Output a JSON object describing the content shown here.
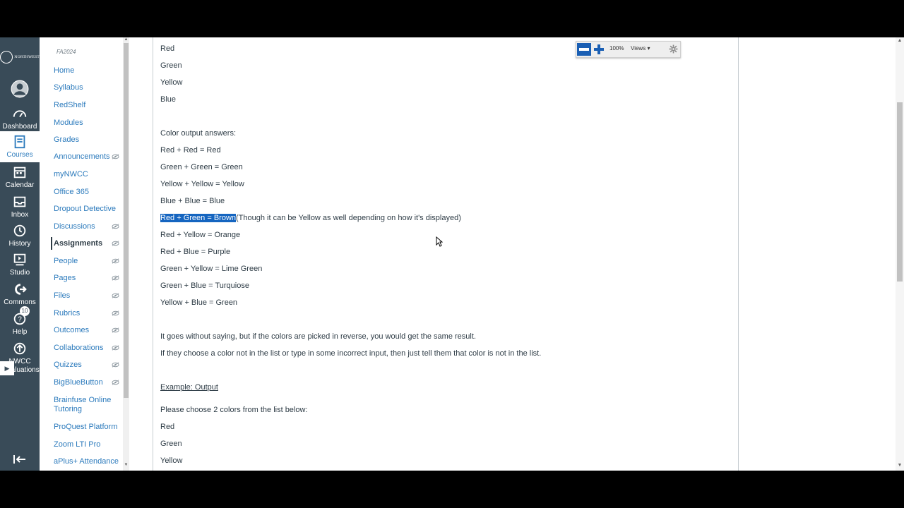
{
  "global_nav": {
    "logo_text": "NORTHWEST",
    "items": [
      {
        "label": "Dashboard"
      },
      {
        "label": "Courses"
      },
      {
        "label": "Calendar"
      },
      {
        "label": "Inbox"
      },
      {
        "label": "History"
      },
      {
        "label": "Studio"
      },
      {
        "label": "Commons"
      },
      {
        "label": "Help",
        "badge": "10"
      },
      {
        "label": "NWCC Evaluations"
      }
    ]
  },
  "course_nav": {
    "term": "FA2024",
    "items": [
      {
        "label": "Home",
        "hidden": false
      },
      {
        "label": "Syllabus",
        "hidden": false
      },
      {
        "label": "RedShelf",
        "hidden": false
      },
      {
        "label": "Modules",
        "hidden": false
      },
      {
        "label": "Grades",
        "hidden": false
      },
      {
        "label": "Announcements",
        "hidden": true
      },
      {
        "label": "myNWCC",
        "hidden": false
      },
      {
        "label": "Office 365",
        "hidden": false
      },
      {
        "label": "Dropout Detective",
        "hidden": false
      },
      {
        "label": "Discussions",
        "hidden": true
      },
      {
        "label": "Assignments",
        "hidden": true
      },
      {
        "label": "People",
        "hidden": true
      },
      {
        "label": "Pages",
        "hidden": true
      },
      {
        "label": "Files",
        "hidden": true
      },
      {
        "label": "Rubrics",
        "hidden": true
      },
      {
        "label": "Outcomes",
        "hidden": true
      },
      {
        "label": "Collaborations",
        "hidden": true
      },
      {
        "label": "Quizzes",
        "hidden": true
      },
      {
        "label": "BigBlueButton",
        "hidden": true
      },
      {
        "label": "Brainfuse Online Tutoring",
        "hidden": false
      },
      {
        "label": "ProQuest Platform",
        "hidden": false
      },
      {
        "label": "Zoom LTI Pro",
        "hidden": false
      },
      {
        "label": "aPlus+ Attendance",
        "hidden": false
      }
    ],
    "active": "Assignments"
  },
  "content": {
    "lines": [
      "Red",
      "Green",
      "Yellow",
      "Blue",
      "Color output answers:",
      "Red + Red = Red",
      "Green + Green = Green",
      "Yellow + Yellow = Yellow",
      "Blue + Blue = Blue",
      "Red + Yellow = Orange",
      "Red + Blue = Purple",
      "Green + Yellow = Lime Green",
      "Green + Blue = Turquiose",
      "Yellow + Blue = Green",
      "It goes without saying, but if the colors are picked in reverse, you would get the same result.",
      "If they choose a color not in the list or type in some incorrect input, then just tell them that color is not in the list.",
      "Example: Output",
      "Please choose 2 colors from the list below:",
      "Red",
      "Green",
      "Yellow"
    ],
    "highlight_line": {
      "selected": "Red + Green = Brown",
      "rest": "(Though it can be Yellow as well depending on how it's displayed)"
    }
  },
  "pdf_toolbar": {
    "zoom": "100%",
    "views_label": "Views"
  }
}
